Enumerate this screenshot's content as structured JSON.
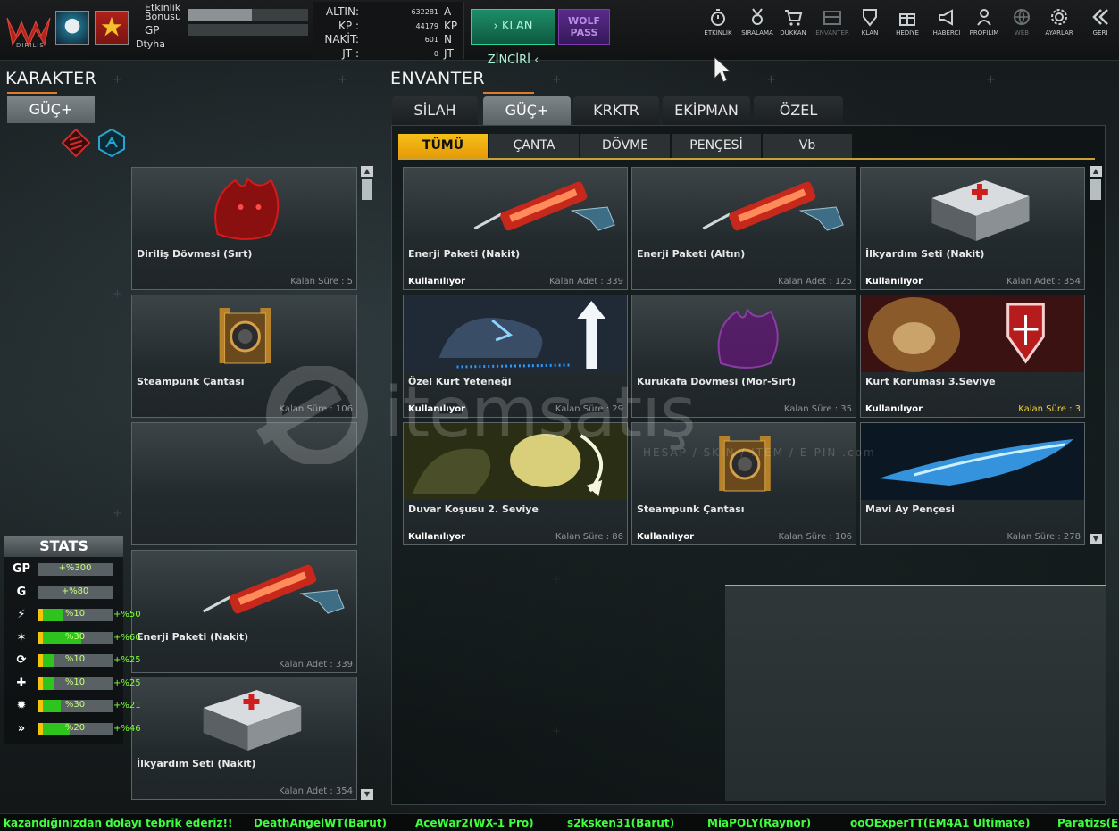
{
  "topbar": {
    "logo_text": "DIRILIS",
    "bonus_label": "Etkinlik Bonusu",
    "bonus_fill": 0.53,
    "gp_label": "GP",
    "gp_fill": 0,
    "username": "Dtyha",
    "currency": [
      {
        "label": "ALTIN:",
        "value": "632281",
        "unit": "A"
      },
      {
        "label": "KP :",
        "value": "44179",
        "unit": "KP"
      },
      {
        "label": "NAKİT:",
        "value": "601",
        "unit": "N"
      },
      {
        "label": "JT :",
        "value": "0",
        "unit": "JT"
      }
    ],
    "klan_button": "› KLAN ZİNCİRİ ‹",
    "wolf_pass_button": "WOLF PASS",
    "nav": [
      {
        "label": "ETKİNLİK",
        "icon": "stopwatch-icon",
        "dim": false
      },
      {
        "label": "SIRALAMA",
        "icon": "medal-icon",
        "dim": false
      },
      {
        "label": "DÜKKAN",
        "icon": "cart-icon",
        "dim": false
      },
      {
        "label": "ENVANTER",
        "icon": "inventory-icon",
        "dim": true
      },
      {
        "label": "KLAN",
        "icon": "shield-icon",
        "dim": false
      },
      {
        "label": "HEDİYE",
        "icon": "gift-icon",
        "dim": false
      },
      {
        "label": "HABERCİ",
        "icon": "megaphone-icon",
        "dim": false
      },
      {
        "label": "PROFİLİM",
        "icon": "profile-icon",
        "dim": false
      },
      {
        "label": "WEB",
        "icon": "globe-icon",
        "dim": true
      },
      {
        "label": "AYARLAR",
        "icon": "gear-icon",
        "dim": false
      },
      {
        "label": "GERİ",
        "icon": "back-icon",
        "dim": false
      }
    ]
  },
  "karakter": {
    "title": "KARAKTER",
    "tab": "GÜÇ+",
    "equipped": [
      {
        "name": "Diriliş Dövmesi (Sırt)",
        "status": "",
        "meta": "Kalan Süre : 5",
        "img": "wolf-tattoo"
      },
      {
        "name": "Steampunk Çantası",
        "status": "",
        "meta": "Kalan Süre : 106",
        "img": "steampunk"
      },
      {
        "name": "",
        "status": "",
        "meta": "",
        "img": "empty"
      },
      {
        "name": "Enerji Paketi (Nakit)",
        "status": "",
        "meta": "Kalan Adet : 339",
        "img": "energy"
      },
      {
        "name": "İlkyardım Seti (Nakit)",
        "status": "",
        "meta": "Kalan Adet : 354",
        "img": "firstaid"
      }
    ]
  },
  "stats": {
    "title": "STATS",
    "rows": [
      {
        "icon": "GP",
        "value": "+%300",
        "bonus": "",
        "fill": 0
      },
      {
        "icon": "G",
        "value": "+%80",
        "bonus": "",
        "fill": 0
      },
      {
        "icon": "speed-icon",
        "value": "%10",
        "bonus": "+%50",
        "fill": 0.3
      },
      {
        "icon": "attack-icon",
        "value": "%30",
        "bonus": "+%60",
        "fill": 0.55
      },
      {
        "icon": "regen-icon",
        "value": "%10",
        "bonus": "+%25",
        "fill": 0.15
      },
      {
        "icon": "heal-icon",
        "value": "%10",
        "bonus": "+%25",
        "fill": 0.15
      },
      {
        "icon": "burst-icon",
        "value": "%30",
        "bonus": "+%21",
        "fill": 0.25
      },
      {
        "icon": "dash-icon",
        "value": "%20",
        "bonus": "+%46",
        "fill": 0.38
      }
    ]
  },
  "envanter": {
    "title": "ENVANTER",
    "tabs": [
      "SİLAH",
      "GÜÇ+",
      "KRKTR",
      "EKİPMAN",
      "ÖZEL"
    ],
    "active_tab": 1,
    "subtabs": [
      "TÜMÜ",
      "ÇANTA",
      "DÖVME",
      "PENÇESİ",
      "Vb"
    ],
    "active_subtab": 0,
    "items": [
      {
        "name": "Enerji Paketi (Nakit)",
        "status": "Kullanılıyor",
        "meta": "Kalan Adet : 339",
        "img": "energy",
        "hl": false
      },
      {
        "name": "Enerji Paketi (Altın)",
        "status": "",
        "meta": "Kalan Adet : 125",
        "img": "energy",
        "hl": false
      },
      {
        "name": "İlkyardım Seti (Nakit)",
        "status": "Kullanılıyor",
        "meta": "Kalan Adet : 354",
        "img": "firstaid",
        "hl": false
      },
      {
        "name": "Özel Kurt Yeteneği",
        "status": "Kullanılıyor",
        "meta": "Kalan Süre : 29",
        "img": "wolfskill",
        "hl": false
      },
      {
        "name": "Kurukafa Dövmesi (Mor-Sırt)",
        "status": "",
        "meta": "Kalan Süre : 35",
        "img": "purple-tattoo",
        "hl": false
      },
      {
        "name": "Kurt Koruması 3.Seviye",
        "status": "Kullanılıyor",
        "meta": "Kalan Süre : 3",
        "img": "wolfshield",
        "hl": true
      },
      {
        "name": "Duvar Koşusu 2. Seviye",
        "status": "Kullanılıyor",
        "meta": "Kalan Süre : 86",
        "img": "wallrun",
        "hl": false
      },
      {
        "name": "Steampunk Çantası",
        "status": "Kullanılıyor",
        "meta": "Kalan Süre : 106",
        "img": "steampunk",
        "hl": false
      },
      {
        "name": "Mavi Ay Pençesi",
        "status": "",
        "meta": "Kalan Süre : 278",
        "img": "bluemoon",
        "hl": false
      }
    ]
  },
  "watermark": {
    "text": "itemsatış",
    "sub": "HESAP / SKIN / ITEM / E-PIN  .com"
  },
  "ticker": [
    "kazandığınızdan dolayı tebrik ederiz!!",
    "DeathAngelWT(Barut)",
    "AceWar2(WX-1 Pro)",
    "s2ksken31(Barut)",
    "MiaPOLY(Raynor)",
    "ooOExperTT(EM4A1 Ultimate)",
    "Paratizs(E"
  ],
  "colors": {
    "accent_orange": "#e07a2c",
    "accent_yellow": "#f5c01a",
    "ticker_green": "#3dff3d",
    "klan_green": "#1d8d68",
    "wolf_purple": "#5b2a8c"
  }
}
